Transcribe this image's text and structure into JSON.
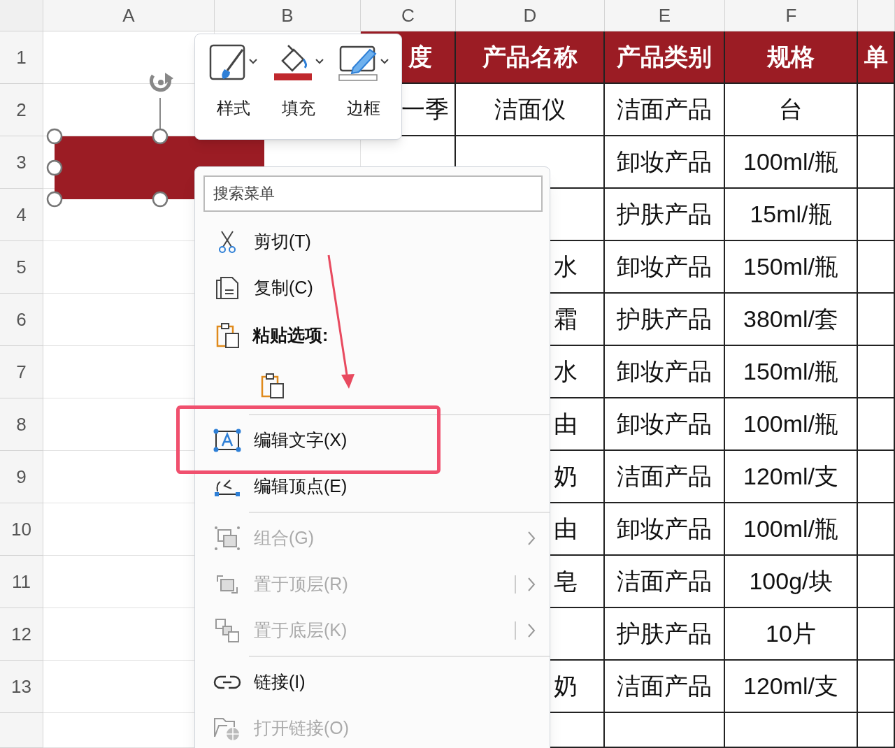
{
  "column_headers": [
    "A",
    "B",
    "C",
    "D",
    "E",
    "F"
  ],
  "row_headers": [
    "1",
    "2",
    "3",
    "4",
    "5",
    "6",
    "7",
    "8",
    "9",
    "10",
    "11",
    "12",
    "13"
  ],
  "table": {
    "header": [
      "度",
      "产品名称",
      "产品类别",
      "规格",
      "单"
    ],
    "rows": [
      {
        "c": "一季",
        "d": "洁面仪",
        "e": "洁面产品",
        "f": "台"
      },
      {
        "e": "卸妆产品",
        "f": "100ml/瓶"
      },
      {
        "e": "护肤产品",
        "f": "15ml/瓶"
      },
      {
        "d": "水",
        "e": "卸妆产品",
        "f": "150ml/瓶"
      },
      {
        "d": "霜",
        "e": "护肤产品",
        "f": "380ml/套"
      },
      {
        "d": "水",
        "e": "卸妆产品",
        "f": "150ml/瓶"
      },
      {
        "d": "由",
        "e": "卸妆产品",
        "f": "100ml/瓶"
      },
      {
        "d": "奶",
        "e": "洁面产品",
        "f": "120ml/支"
      },
      {
        "d": "由",
        "e": "卸妆产品",
        "f": "100ml/瓶"
      },
      {
        "d": "皂",
        "e": "洁面产品",
        "f": "100g/块"
      },
      {
        "e": "护肤产品",
        "f": "10片"
      },
      {
        "d": "奶",
        "e": "洁面产品",
        "f": "120ml/支"
      }
    ]
  },
  "shape": {
    "selected": true
  },
  "toolbar": [
    {
      "kind": "style",
      "label": "样式"
    },
    {
      "kind": "fill",
      "label": "填充"
    },
    {
      "kind": "border",
      "label": "边框"
    }
  ],
  "menu": {
    "search": {
      "placeholder": "搜索菜单"
    },
    "items": [
      {
        "kind": "cut",
        "label": "剪切(T)",
        "disabled": false
      },
      {
        "kind": "copy",
        "label": "复制(C)",
        "disabled": false
      },
      {
        "kind": "heading",
        "label": "粘贴选项:"
      },
      {
        "kind": "paste-button"
      },
      {
        "kind": "separator"
      },
      {
        "kind": "edit-text",
        "label": "编辑文字(X)",
        "disabled": false,
        "highlighted": true
      },
      {
        "kind": "edit-points",
        "label": "编辑顶点(E)",
        "disabled": false
      },
      {
        "kind": "separator"
      },
      {
        "kind": "group",
        "label": "组合(G)",
        "disabled": true,
        "submenu": true
      },
      {
        "kind": "front",
        "label": "置于顶层(R)",
        "disabled": true,
        "submenu": true,
        "split": true
      },
      {
        "kind": "back",
        "label": "置于底层(K)",
        "disabled": true,
        "submenu": true,
        "split": true
      },
      {
        "kind": "separator"
      },
      {
        "kind": "link",
        "label": "链接(I)",
        "disabled": false
      },
      {
        "kind": "open-link",
        "label": "打开链接(O)",
        "disabled": true
      }
    ]
  }
}
